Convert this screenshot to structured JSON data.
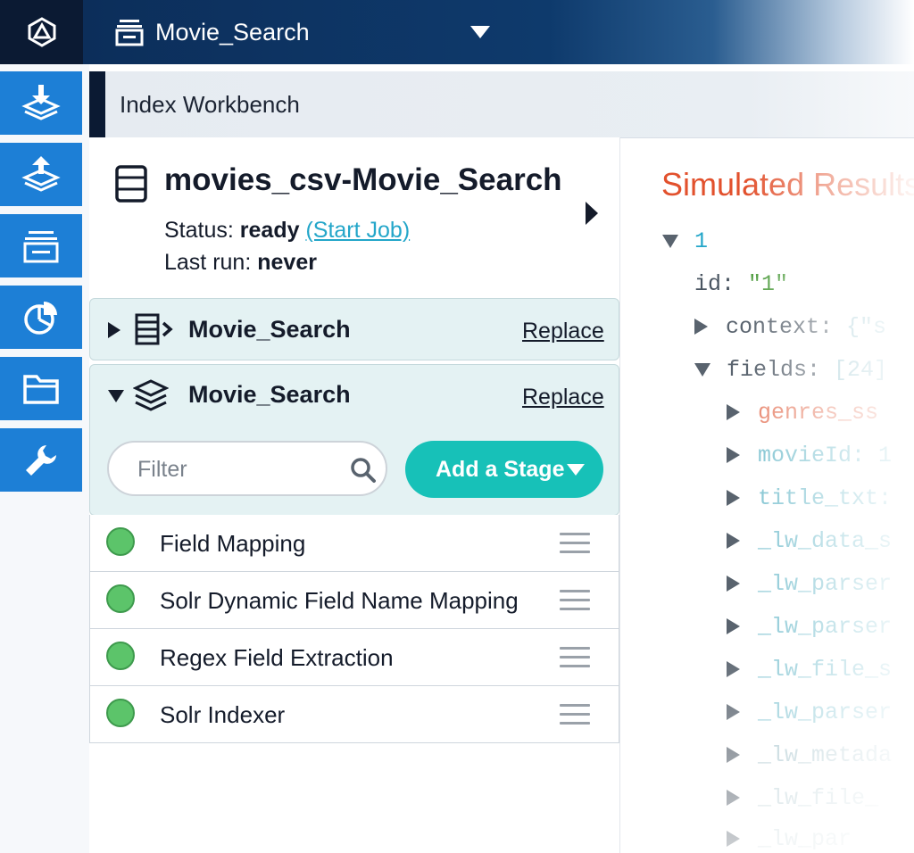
{
  "topbar": {
    "logo": "fusion-logo-icon",
    "app_icon": "app-stack-icon",
    "app_name": "Movie_Search"
  },
  "leftnav": {
    "items": [
      {
        "icon": "index-download-icon"
      },
      {
        "icon": "query-upload-icon"
      },
      {
        "icon": "collections-icon"
      },
      {
        "icon": "analytics-pie-icon"
      },
      {
        "icon": "folder-icon"
      },
      {
        "icon": "wrench-icon"
      }
    ]
  },
  "workbench": {
    "title": "Index Workbench"
  },
  "datasource": {
    "name": "movies_csv-Movie_Search",
    "status_label": "Status:",
    "status_value": "ready",
    "start_job": "(Start Job)",
    "last_run_label": "Last run:",
    "last_run_value": "never"
  },
  "parser_card": {
    "title": "Movie_Search",
    "replace": "Replace"
  },
  "pipeline_card": {
    "title": "Movie_Search",
    "replace": "Replace",
    "filter_placeholder": "Filter",
    "add_stage": "Add a Stage"
  },
  "stages": [
    {
      "label": "Field Mapping"
    },
    {
      "label": "Solr Dynamic Field Name Mapping"
    },
    {
      "label": "Regex Field Extraction"
    },
    {
      "label": "Solr Indexer"
    }
  ],
  "results": {
    "title": "Simulated Results",
    "doc_number": "1",
    "id_key": "id:",
    "id_value": "\"1\"",
    "context_key": "context:",
    "context_preview": "{\"s",
    "fields_key": "fields:",
    "fields_count": "[24]",
    "fields": [
      {
        "name": "genres_ss"
      },
      {
        "name": "movieId: 1"
      },
      {
        "name": "title_txt:"
      },
      {
        "name": "_lw_data_s"
      },
      {
        "name": "_lw_parser"
      },
      {
        "name": "_lw_parser"
      },
      {
        "name": "_lw_file_s"
      },
      {
        "name": "_lw_parser"
      },
      {
        "name": "_lw_metada"
      },
      {
        "name": "_lw_file_"
      },
      {
        "name": "_lw_par"
      }
    ],
    "colors": {
      "title": "#e2512d",
      "number": "#23a6c9",
      "string": "#4a9a3a",
      "field": "#7fc3d1",
      "highlight_field": "#e8876f"
    }
  },
  "colors": {
    "nav_blue": "#1d7fd6",
    "teal": "#17c1b8",
    "status_green": "#5cc46a",
    "dark_navy": "#0b1a33"
  }
}
